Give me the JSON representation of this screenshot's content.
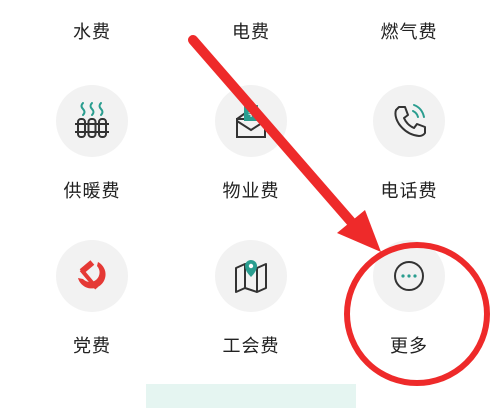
{
  "top_row": [
    {
      "label": "水费"
    },
    {
      "label": "电费"
    },
    {
      "label": "燃气费"
    }
  ],
  "middle_row": [
    {
      "label": "供暖费",
      "icon": "radiator-icon"
    },
    {
      "label": "物业费",
      "icon": "property-payment-icon"
    },
    {
      "label": "电话费",
      "icon": "phone-icon"
    }
  ],
  "bottom_row": [
    {
      "label": "党费",
      "icon": "hammer-sickle-icon"
    },
    {
      "label": "工会费",
      "icon": "map-pin-icon"
    },
    {
      "label": "更多",
      "icon": "more-icon"
    }
  ],
  "colors": {
    "teal_icon": "#2a9d8f",
    "party_red": "#e53935",
    "annotation_red": "#ee2a2a",
    "icon_bg": "#f2f2f2"
  }
}
